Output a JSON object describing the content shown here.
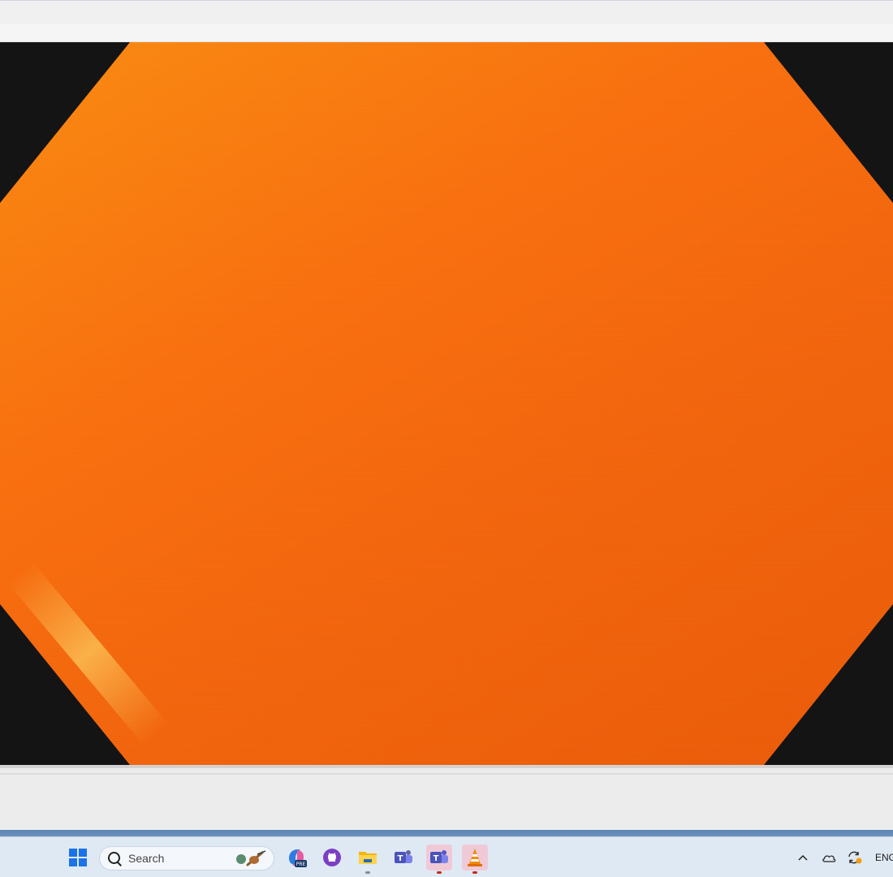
{
  "taskbar": {
    "search_placeholder": "Search",
    "items": [
      {
        "name": "start-button"
      },
      {
        "name": "copilot-pre-app"
      },
      {
        "name": "github-app"
      },
      {
        "name": "file-explorer-app"
      },
      {
        "name": "teams-classic-app"
      },
      {
        "name": "teams-app"
      },
      {
        "name": "vlc-app"
      }
    ],
    "tray": {
      "language": "ENG"
    }
  },
  "colors": {
    "video_orange": "#f86f0e",
    "letterbox": "#141414",
    "taskbar_bg": "#dfe9f4",
    "accent_blue": "#1a73e8"
  }
}
